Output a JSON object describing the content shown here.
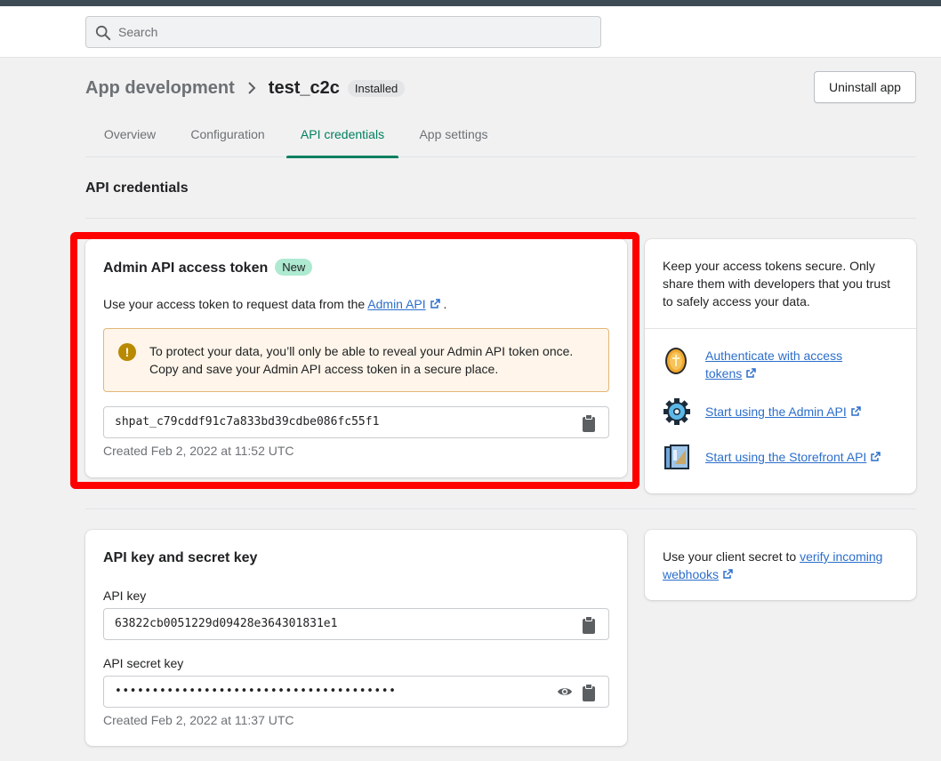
{
  "search": {
    "placeholder": "Search"
  },
  "header": {
    "breadcrumb_parent": "App development",
    "title": "test_c2c",
    "status_badge": "Installed",
    "uninstall_label": "Uninstall app"
  },
  "tabs": [
    {
      "label": "Overview"
    },
    {
      "label": "Configuration"
    },
    {
      "label": "API credentials",
      "active": true
    },
    {
      "label": "App settings"
    }
  ],
  "section_title": "API credentials",
  "admin_token": {
    "title": "Admin API access token",
    "new_badge": "New",
    "desc_prefix": "Use your access token to request data from the",
    "desc_link": "Admin API",
    "desc_suffix": ".",
    "warning_line1": "To protect your data, you’ll only be able to reveal your Admin API token once.",
    "warning_line2": "Copy and save your Admin API access token in a secure place.",
    "token": "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",
    "created": "Created Feb 2, 2022 at 11:52 UTC"
  },
  "sidebar_tips": {
    "text": "Keep your access tokens secure. Only share them with developers that you trust to safely access your data.",
    "resources": [
      {
        "label_line1": "Authenticate with access",
        "label_line2": "tokens",
        "icon": "coin-icon"
      },
      {
        "label_line1": "Start using the Admin API",
        "icon": "gear-icon"
      },
      {
        "label_line1": "Start using the Storefront API",
        "icon": "storefront-icon"
      }
    ]
  },
  "api_keys": {
    "title": "API key and secret key",
    "api_key_label": "API key",
    "api_key": "63822cb0051229d09428e364301831e1",
    "secret_label": "API secret key",
    "secret_masked": "••••••••••••••••••••••••••••••••••••••",
    "created": "Created Feb 2, 2022 at 11:37 UTC"
  },
  "webhooks_tip": {
    "prefix": "Use your client secret to",
    "link_line1": "verify incoming",
    "link_line2": "webhooks"
  },
  "colors": {
    "accent": "#008060",
    "highlight": "#ff0000",
    "link": "#2c6ecb",
    "warning_bg": "#fff5ea"
  }
}
